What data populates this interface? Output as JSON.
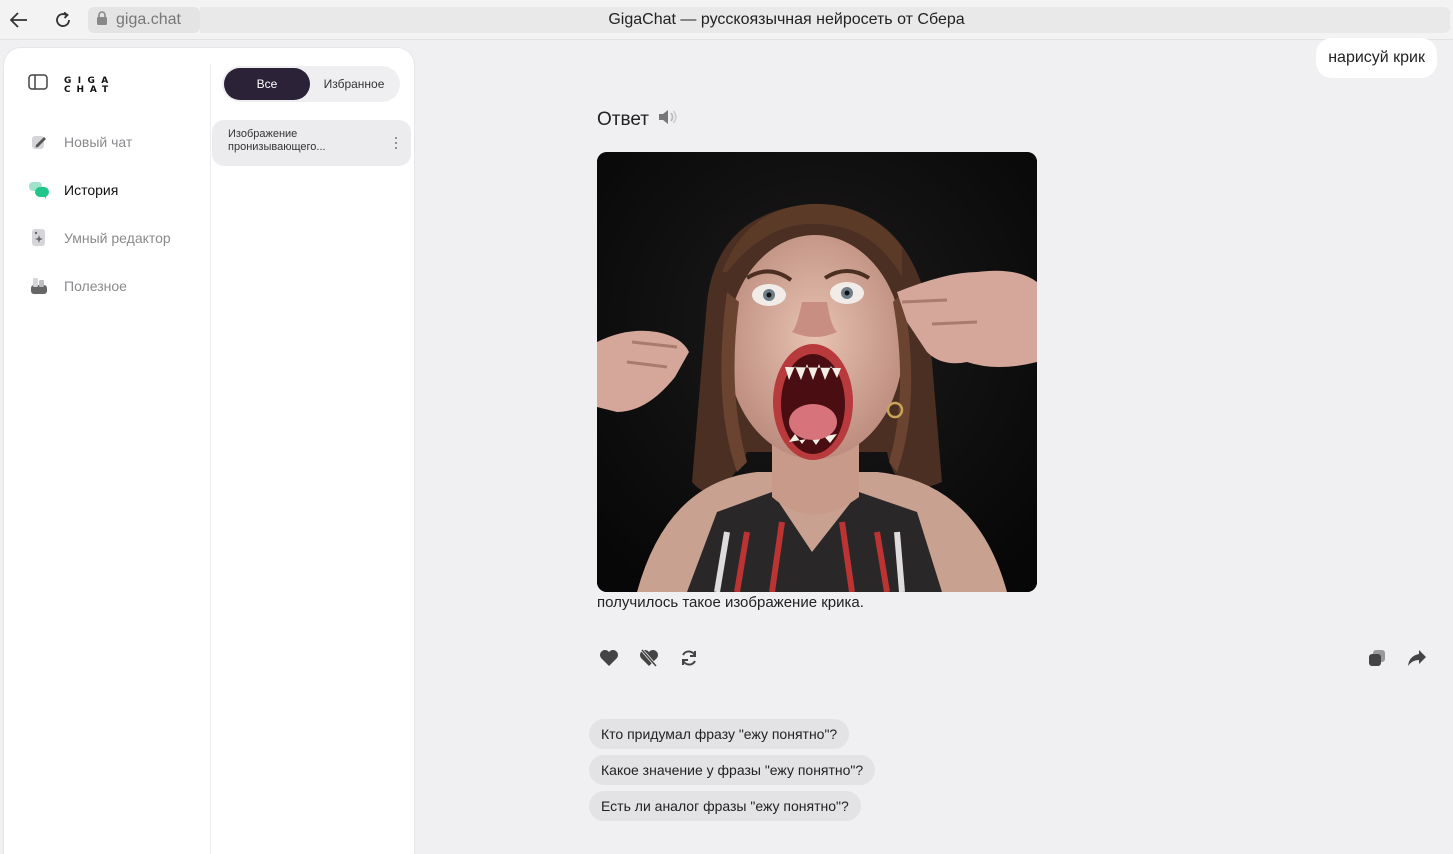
{
  "browser": {
    "url": "giga.chat",
    "page_title": "GigaChat — русскоязычная нейросеть от Сбера"
  },
  "sidebar": {
    "logo": "GIGA CHAT",
    "nav": [
      {
        "label": "Новый чат",
        "icon": "pencil-icon"
      },
      {
        "label": "История",
        "icon": "chat-bubbles-icon",
        "active": true
      },
      {
        "label": "Умный редактор",
        "icon": "sparkle-document-icon"
      },
      {
        "label": "Полезное",
        "icon": "toolbox-icon"
      }
    ],
    "filter": {
      "all": "Все",
      "favorites": "Избранное",
      "selected": "Все"
    },
    "history": [
      {
        "title": "Изображение пронизывающего..."
      }
    ]
  },
  "chat": {
    "user_message": "нарисуй крик",
    "answer_label": "Ответ",
    "answer_caption": "получилось такое изображение крика.",
    "suggestions": [
      "Кто придумал фразу \"ежу понятно\"?",
      "Какое значение у фразы \"ежу понятно\"?",
      "Есть ли аналог фразы \"ежу понятно\"?"
    ]
  },
  "colors": {
    "accent_dark": "#2b2237",
    "history_active": "#21c48a",
    "background": "#f0f0f3"
  }
}
